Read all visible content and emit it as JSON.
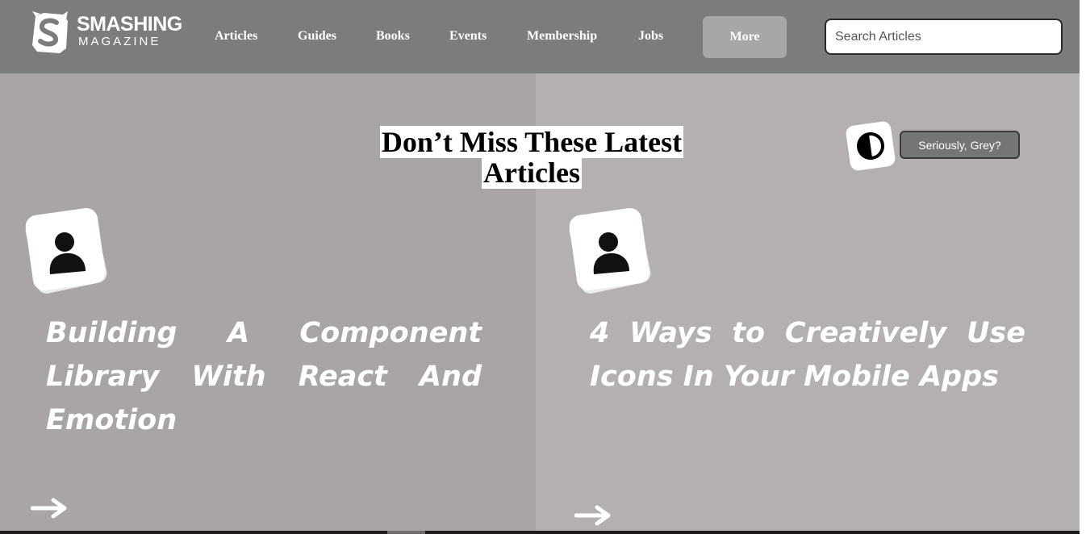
{
  "header": {
    "logo_line1": "SMASHING",
    "logo_line2": "MAGAZINE",
    "logo_icon": "smashing-cat-logo",
    "nav": [
      "Articles",
      "Guides",
      "Books",
      "Events",
      "Membership",
      "Jobs"
    ],
    "more_label": "More",
    "search_placeholder": "Search Articles"
  },
  "main": {
    "section_title": "Don’t Miss These Latest Articles",
    "grey_toggle_icon": "contrast-icon",
    "grey_toggle_label": "Seriously, Grey?",
    "articles": [
      {
        "title": "Building A Component Library With React And Emotion",
        "author_icon": "person-icon",
        "link_icon": "arrow-right-icon"
      },
      {
        "title": "4 Ways to Creatively Use Icons In Your Mobile Apps",
        "author_icon": "person-icon",
        "link_icon": "arrow-right-icon"
      }
    ]
  },
  "colors": {
    "header_bg": "#7c7c7c",
    "left_column_bg": "#a9a5a4",
    "right_column_bg": "#b5b0b0",
    "more_button_bg": "#a7a7a7",
    "grey_button_bg": "#757575"
  }
}
